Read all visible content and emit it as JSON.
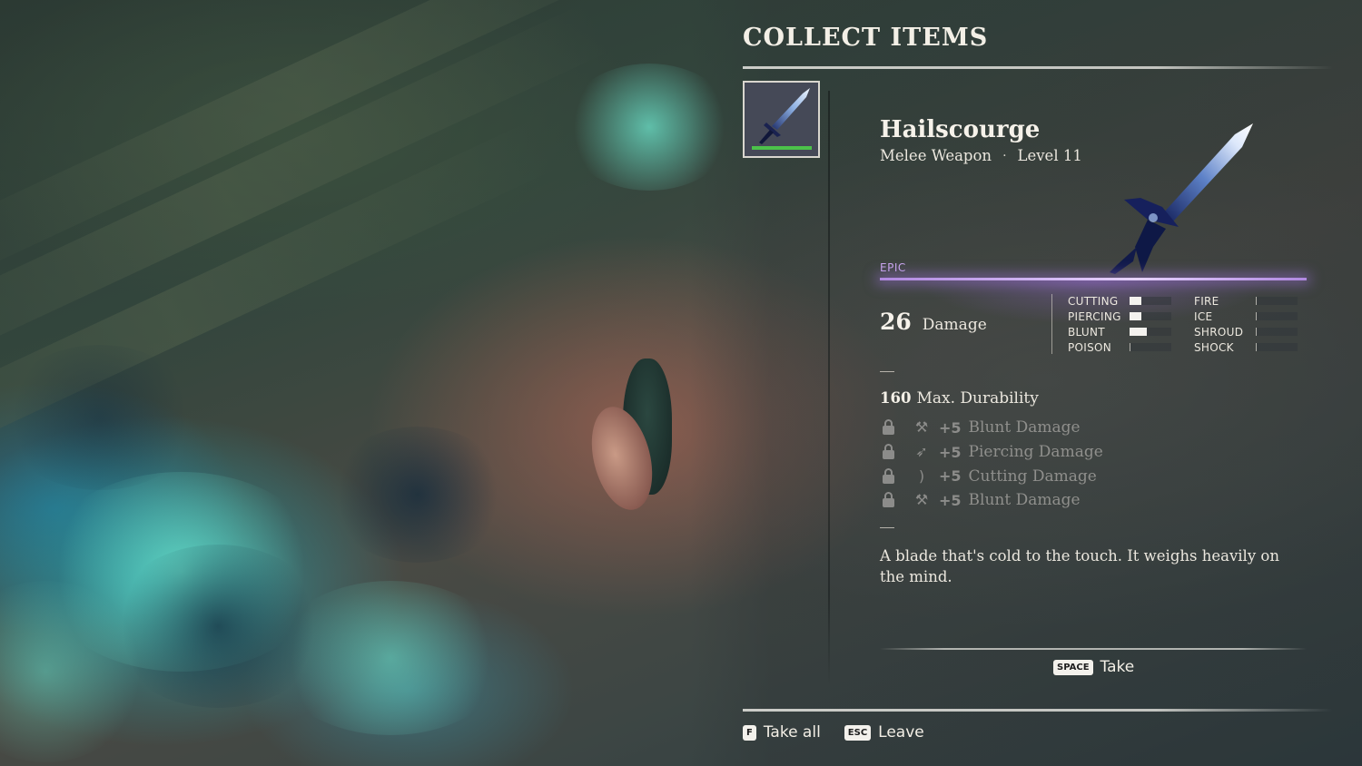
{
  "header": {
    "title": "COLLECT ITEMS"
  },
  "item": {
    "name": "Hailscourge",
    "type": "Melee Weapon",
    "separator": "·",
    "level": "Level 11",
    "rarity": "EPIC",
    "rarity_color": "#c9a6ee",
    "durability_bar_fraction": 0.95,
    "damage_value": "26",
    "damage_label": "Damage",
    "durability_value": "160",
    "durability_label": "Max. Durability",
    "description": "A blade that's cold to the touch. It weighs heavily on the mind."
  },
  "stats": {
    "left": [
      {
        "name": "CUTTING",
        "fraction": 0.28
      },
      {
        "name": "PIERCING",
        "fraction": 0.28
      },
      {
        "name": "BLUNT",
        "fraction": 0.42
      },
      {
        "name": "POISON",
        "fraction": 0
      }
    ],
    "right": [
      {
        "name": "FIRE",
        "fraction": 0
      },
      {
        "name": "ICE",
        "fraction": 0
      },
      {
        "name": "SHROUD",
        "fraction": 0
      },
      {
        "name": "SHOCK",
        "fraction": 0
      }
    ]
  },
  "perks": [
    {
      "icon": "hammer-icon",
      "glyph": "⚒",
      "plus": "+5",
      "text": "Blunt Damage",
      "locked": true
    },
    {
      "icon": "arrow-icon",
      "glyph": "➶",
      "plus": "+5",
      "text": "Piercing Damage",
      "locked": true
    },
    {
      "icon": "slash-icon",
      "glyph": ")",
      "plus": "+5",
      "text": "Cutting Damage",
      "locked": true
    },
    {
      "icon": "hammer-icon",
      "glyph": "⚒",
      "plus": "+5",
      "text": "Blunt Damage",
      "locked": true
    }
  ],
  "actions": {
    "take_key": "SPACE",
    "take_label": "Take",
    "take_all_key": "F",
    "take_all_label": "Take all",
    "leave_key": "ESC",
    "leave_label": "Leave"
  },
  "colors": {
    "durability_bar": "#4cc24a",
    "stat_fill": "#f4f2ee",
    "locked_text": "#8f8f8c"
  }
}
